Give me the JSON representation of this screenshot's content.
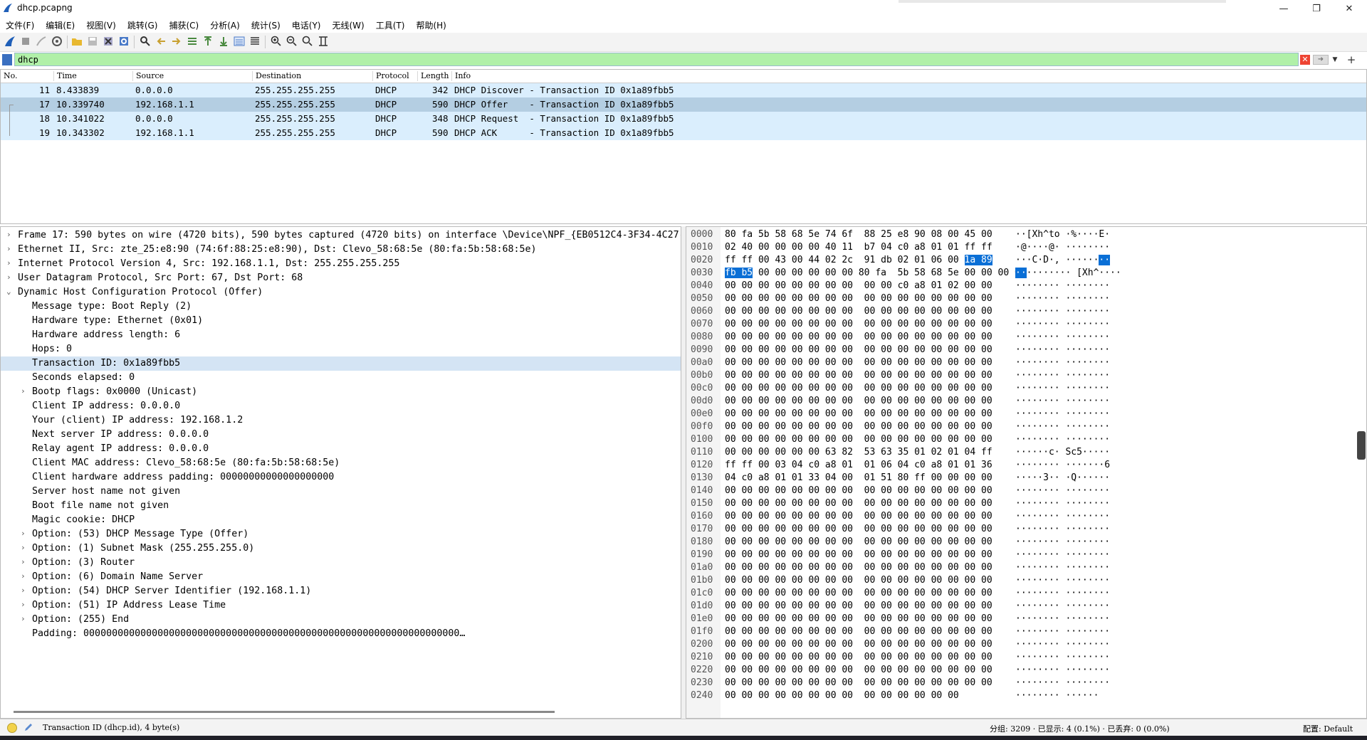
{
  "window": {
    "title": "dhcp.pcapng"
  },
  "menu": [
    "文件(F)",
    "编辑(E)",
    "视图(V)",
    "跳转(G)",
    "捕获(C)",
    "分析(A)",
    "统计(S)",
    "电话(Y)",
    "无线(W)",
    "工具(T)",
    "帮助(H)"
  ],
  "filter": {
    "value": "dhcp"
  },
  "packet_list": {
    "columns": [
      "No.",
      "Time",
      "Source",
      "Destination",
      "Protocol",
      "Length",
      "Info"
    ],
    "rows": [
      {
        "no": "11",
        "time": "8.433839",
        "src": "0.0.0.0",
        "dst": "255.255.255.255",
        "proto": "DHCP",
        "len": "342",
        "info": "DHCP Discover - Transaction ID 0x1a89fbb5"
      },
      {
        "no": "17",
        "time": "10.339740",
        "src": "192.168.1.1",
        "dst": "255.255.255.255",
        "proto": "DHCP",
        "len": "590",
        "info": "DHCP Offer    - Transaction ID 0x1a89fbb5"
      },
      {
        "no": "18",
        "time": "10.341022",
        "src": "0.0.0.0",
        "dst": "255.255.255.255",
        "proto": "DHCP",
        "len": "348",
        "info": "DHCP Request  - Transaction ID 0x1a89fbb5"
      },
      {
        "no": "19",
        "time": "10.343302",
        "src": "192.168.1.1",
        "dst": "255.255.255.255",
        "proto": "DHCP",
        "len": "590",
        "info": "DHCP ACK      - Transaction ID 0x1a89fbb5"
      }
    ]
  },
  "details": [
    {
      "t": "Frame 17: 590 bytes on wire (4720 bits), 590 bytes captured (4720 bits) on interface \\Device\\NPF_{EB0512C4-3F34-4C27-",
      "lvl": 0,
      "arrow": "›"
    },
    {
      "t": "Ethernet II, Src: zte_25:e8:90 (74:6f:88:25:e8:90), Dst: Clevo_58:68:5e (80:fa:5b:58:68:5e)",
      "lvl": 0,
      "arrow": "›"
    },
    {
      "t": "Internet Protocol Version 4, Src: 192.168.1.1, Dst: 255.255.255.255",
      "lvl": 0,
      "arrow": "›"
    },
    {
      "t": "User Datagram Protocol, Src Port: 67, Dst Port: 68",
      "lvl": 0,
      "arrow": "›"
    },
    {
      "t": "Dynamic Host Configuration Protocol (Offer)",
      "lvl": 0,
      "arrow": "⌄"
    },
    {
      "t": "Message type: Boot Reply (2)",
      "lvl": 1,
      "arrow": ""
    },
    {
      "t": "Hardware type: Ethernet (0x01)",
      "lvl": 1,
      "arrow": ""
    },
    {
      "t": "Hardware address length: 6",
      "lvl": 1,
      "arrow": ""
    },
    {
      "t": "Hops: 0",
      "lvl": 1,
      "arrow": ""
    },
    {
      "t": "Transaction ID: 0x1a89fbb5",
      "lvl": 1,
      "arrow": "",
      "sel": true
    },
    {
      "t": "Seconds elapsed: 0",
      "lvl": 1,
      "arrow": ""
    },
    {
      "t": "Bootp flags: 0x0000 (Unicast)",
      "lvl": 1,
      "arrow": "›"
    },
    {
      "t": "Client IP address: 0.0.0.0",
      "lvl": 1,
      "arrow": ""
    },
    {
      "t": "Your (client) IP address: 192.168.1.2",
      "lvl": 1,
      "arrow": ""
    },
    {
      "t": "Next server IP address: 0.0.0.0",
      "lvl": 1,
      "arrow": ""
    },
    {
      "t": "Relay agent IP address: 0.0.0.0",
      "lvl": 1,
      "arrow": ""
    },
    {
      "t": "Client MAC address: Clevo_58:68:5e (80:fa:5b:58:68:5e)",
      "lvl": 1,
      "arrow": ""
    },
    {
      "t": "Client hardware address padding: 00000000000000000000",
      "lvl": 1,
      "arrow": ""
    },
    {
      "t": "Server host name not given",
      "lvl": 1,
      "arrow": ""
    },
    {
      "t": "Boot file name not given",
      "lvl": 1,
      "arrow": ""
    },
    {
      "t": "Magic cookie: DHCP",
      "lvl": 1,
      "arrow": ""
    },
    {
      "t": "Option: (53) DHCP Message Type (Offer)",
      "lvl": 1,
      "arrow": "›"
    },
    {
      "t": "Option: (1) Subnet Mask (255.255.255.0)",
      "lvl": 1,
      "arrow": "›"
    },
    {
      "t": "Option: (3) Router",
      "lvl": 1,
      "arrow": "›"
    },
    {
      "t": "Option: (6) Domain Name Server",
      "lvl": 1,
      "arrow": "›"
    },
    {
      "t": "Option: (54) DHCP Server Identifier (192.168.1.1)",
      "lvl": 1,
      "arrow": "›"
    },
    {
      "t": "Option: (51) IP Address Lease Time",
      "lvl": 1,
      "arrow": "›"
    },
    {
      "t": "Option: (255) End",
      "lvl": 1,
      "arrow": "›"
    },
    {
      "t": "Padding: 000000000000000000000000000000000000000000000000000000000000000000…",
      "lvl": 1,
      "arrow": ""
    }
  ],
  "bytes": [
    {
      "off": "0000",
      "hex": "80 fa 5b 58 68 5e 74 6f  88 25 e8 90 08 00 45 00",
      "asc": "··[Xh^to ·%····E·"
    },
    {
      "off": "0010",
      "hex": "02 40 00 00 00 00 40 11  b7 04 c0 a8 01 01 ff ff",
      "asc": "·@····@· ········"
    },
    {
      "off": "0020",
      "hex": "ff ff 00 43 00 44 02 2c  91 db 02 01 06 00 ",
      "hl": "1a 89",
      "asc": "···C·D·, ······",
      "aschl": "··"
    },
    {
      "off": "0030",
      "hex": "00 00 00 00 00 00 80 fa  5b 58 68 5e 00 00 00 00",
      "hlpre": "fb b5",
      "ascpre": "··",
      "asc": "········ [Xh^····"
    },
    {
      "off": "0040",
      "hex": "00 00 00 00 00 00 00 00  00 00 c0 a8 01 02 00 00",
      "asc": "········ ········"
    },
    {
      "off": "0050",
      "hex": "00 00 00 00 00 00 00 00  00 00 00 00 00 00 00 00",
      "asc": "········ ········"
    },
    {
      "off": "0060",
      "hex": "00 00 00 00 00 00 00 00  00 00 00 00 00 00 00 00",
      "asc": "········ ········"
    },
    {
      "off": "0070",
      "hex": "00 00 00 00 00 00 00 00  00 00 00 00 00 00 00 00",
      "asc": "········ ········"
    },
    {
      "off": "0080",
      "hex": "00 00 00 00 00 00 00 00  00 00 00 00 00 00 00 00",
      "asc": "········ ········"
    },
    {
      "off": "0090",
      "hex": "00 00 00 00 00 00 00 00  00 00 00 00 00 00 00 00",
      "asc": "········ ········"
    },
    {
      "off": "00a0",
      "hex": "00 00 00 00 00 00 00 00  00 00 00 00 00 00 00 00",
      "asc": "········ ········"
    },
    {
      "off": "00b0",
      "hex": "00 00 00 00 00 00 00 00  00 00 00 00 00 00 00 00",
      "asc": "········ ········"
    },
    {
      "off": "00c0",
      "hex": "00 00 00 00 00 00 00 00  00 00 00 00 00 00 00 00",
      "asc": "········ ········"
    },
    {
      "off": "00d0",
      "hex": "00 00 00 00 00 00 00 00  00 00 00 00 00 00 00 00",
      "asc": "········ ········"
    },
    {
      "off": "00e0",
      "hex": "00 00 00 00 00 00 00 00  00 00 00 00 00 00 00 00",
      "asc": "········ ········"
    },
    {
      "off": "00f0",
      "hex": "00 00 00 00 00 00 00 00  00 00 00 00 00 00 00 00",
      "asc": "········ ········"
    },
    {
      "off": "0100",
      "hex": "00 00 00 00 00 00 00 00  00 00 00 00 00 00 00 00",
      "asc": "········ ········"
    },
    {
      "off": "0110",
      "hex": "00 00 00 00 00 00 63 82  53 63 35 01 02 01 04 ff",
      "asc": "······c· Sc5·····"
    },
    {
      "off": "0120",
      "hex": "ff ff 00 03 04 c0 a8 01  01 06 04 c0 a8 01 01 36",
      "asc": "········ ·······6"
    },
    {
      "off": "0130",
      "hex": "04 c0 a8 01 01 33 04 00  01 51 80 ff 00 00 00 00",
      "asc": "·····3·· ·Q······"
    },
    {
      "off": "0140",
      "hex": "00 00 00 00 00 00 00 00  00 00 00 00 00 00 00 00",
      "asc": "········ ········"
    },
    {
      "off": "0150",
      "hex": "00 00 00 00 00 00 00 00  00 00 00 00 00 00 00 00",
      "asc": "········ ········"
    },
    {
      "off": "0160",
      "hex": "00 00 00 00 00 00 00 00  00 00 00 00 00 00 00 00",
      "asc": "········ ········"
    },
    {
      "off": "0170",
      "hex": "00 00 00 00 00 00 00 00  00 00 00 00 00 00 00 00",
      "asc": "········ ········"
    },
    {
      "off": "0180",
      "hex": "00 00 00 00 00 00 00 00  00 00 00 00 00 00 00 00",
      "asc": "········ ········"
    },
    {
      "off": "0190",
      "hex": "00 00 00 00 00 00 00 00  00 00 00 00 00 00 00 00",
      "asc": "········ ········"
    },
    {
      "off": "01a0",
      "hex": "00 00 00 00 00 00 00 00  00 00 00 00 00 00 00 00",
      "asc": "········ ········"
    },
    {
      "off": "01b0",
      "hex": "00 00 00 00 00 00 00 00  00 00 00 00 00 00 00 00",
      "asc": "········ ········"
    },
    {
      "off": "01c0",
      "hex": "00 00 00 00 00 00 00 00  00 00 00 00 00 00 00 00",
      "asc": "········ ········"
    },
    {
      "off": "01d0",
      "hex": "00 00 00 00 00 00 00 00  00 00 00 00 00 00 00 00",
      "asc": "········ ········"
    },
    {
      "off": "01e0",
      "hex": "00 00 00 00 00 00 00 00  00 00 00 00 00 00 00 00",
      "asc": "········ ········"
    },
    {
      "off": "01f0",
      "hex": "00 00 00 00 00 00 00 00  00 00 00 00 00 00 00 00",
      "asc": "········ ········"
    },
    {
      "off": "0200",
      "hex": "00 00 00 00 00 00 00 00  00 00 00 00 00 00 00 00",
      "asc": "········ ········"
    },
    {
      "off": "0210",
      "hex": "00 00 00 00 00 00 00 00  00 00 00 00 00 00 00 00",
      "asc": "········ ········"
    },
    {
      "off": "0220",
      "hex": "00 00 00 00 00 00 00 00  00 00 00 00 00 00 00 00",
      "asc": "········ ········"
    },
    {
      "off": "0230",
      "hex": "00 00 00 00 00 00 00 00  00 00 00 00 00 00 00 00",
      "asc": "········ ········"
    },
    {
      "off": "0240",
      "hex": "00 00 00 00 00 00 00 00  00 00 00 00 00 00",
      "asc": "········ ······"
    }
  ],
  "status": {
    "field": "Transaction ID (dhcp.id), 4 byte(s)",
    "packets": "分组: 3209 · 已显示: 4 (0.1%) · 已丢弃: 0 (0.0%)",
    "profile": "配置: Default"
  }
}
